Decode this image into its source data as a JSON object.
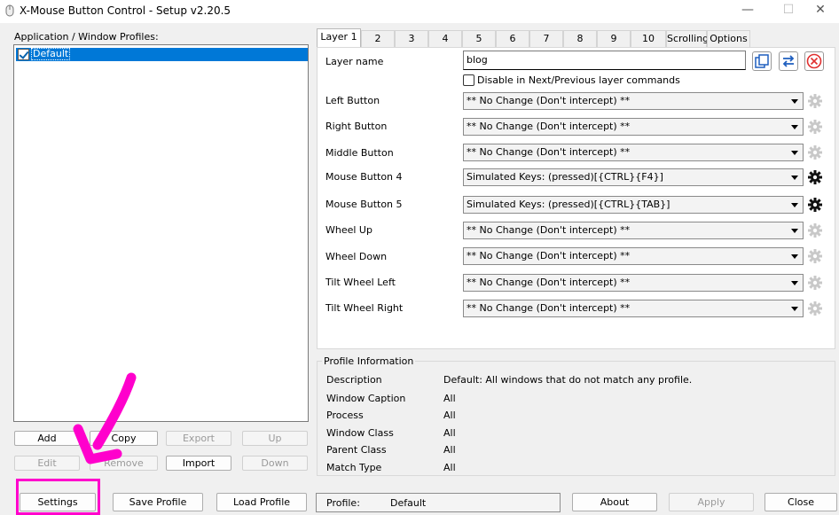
{
  "window": {
    "title": "X-Mouse Button Control - Setup v2.20.5",
    "min_icon": "minimize-icon",
    "max_icon": "maximize-icon",
    "close_icon": "close-icon"
  },
  "profiles": {
    "label": "Application / Window Profiles:",
    "items": [
      {
        "name": "Default",
        "checked": true
      }
    ],
    "buttons": {
      "add": "Add",
      "copy": "Copy",
      "export": "Export",
      "up": "Up",
      "edit": "Edit",
      "remove": "Remove",
      "import": "Import",
      "down": "Down"
    }
  },
  "tabs": [
    "Layer 1",
    "2",
    "3",
    "4",
    "5",
    "6",
    "7",
    "8",
    "9",
    "10",
    "Scrolling",
    "Options"
  ],
  "layer": {
    "name_label": "Layer name",
    "name_value": "blog",
    "disable_label": "Disable in Next/Previous layer commands",
    "rows": [
      {
        "label": "Left Button",
        "value": "** No Change (Don't intercept) **",
        "gear_active": false
      },
      {
        "label": "Right Button",
        "value": "** No Change (Don't intercept) **",
        "gear_active": false
      },
      {
        "label": "Middle Button",
        "value": "** No Change (Don't intercept) **",
        "gear_active": false
      },
      {
        "label": "Mouse Button 4",
        "value": "Simulated Keys: (pressed)[{CTRL}{F4}]",
        "gear_active": true
      },
      {
        "label": "Mouse Button 5",
        "value": "Simulated Keys: (pressed)[{CTRL}{TAB}]",
        "gear_active": true
      },
      {
        "label": "Wheel Up",
        "value": "** No Change (Don't intercept) **",
        "gear_active": false
      },
      {
        "label": "Wheel Down",
        "value": "** No Change (Don't intercept) **",
        "gear_active": false
      },
      {
        "label": "Tilt Wheel Left",
        "value": "** No Change (Don't intercept) **",
        "gear_active": false
      },
      {
        "label": "Tilt Wheel Right",
        "value": "** No Change (Don't intercept) **",
        "gear_active": false
      }
    ]
  },
  "profile_info": {
    "title": "Profile Information",
    "rows": [
      {
        "label": "Description",
        "value": "Default: All windows that do not match any profile."
      },
      {
        "label": "Window Caption",
        "value": "All"
      },
      {
        "label": "Process",
        "value": "All"
      },
      {
        "label": "Window Class",
        "value": "All"
      },
      {
        "label": "Parent Class",
        "value": "All"
      },
      {
        "label": "Match Type",
        "value": "All"
      }
    ]
  },
  "bottom": {
    "settings": "Settings",
    "save_profile": "Save Profile",
    "load_profile": "Load Profile",
    "status_label": "Profile:",
    "status_value": "Default",
    "about": "About",
    "apply": "Apply",
    "close": "Close"
  },
  "annotation": {
    "color": "#ff00cc"
  }
}
